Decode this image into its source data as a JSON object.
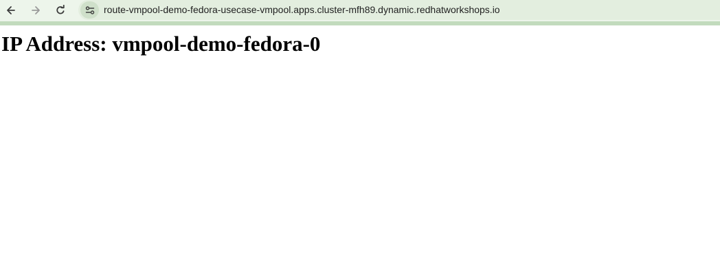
{
  "browser": {
    "url": "route-vmpool-demo-fedora-usecase-vmpool.apps.cluster-mfh89.dynamic.redhatworkshops.io",
    "icons": {
      "back": "arrow-left-icon",
      "forward": "arrow-right-icon",
      "reload": "reload-icon",
      "site_info": "tune-icon"
    },
    "colors": {
      "toolbar": "#edf5eb",
      "omnibox": "#e3eedf",
      "progress": "#c2dbbd"
    }
  },
  "page": {
    "heading": "IP Address: vmpool-demo-fedora-0"
  }
}
